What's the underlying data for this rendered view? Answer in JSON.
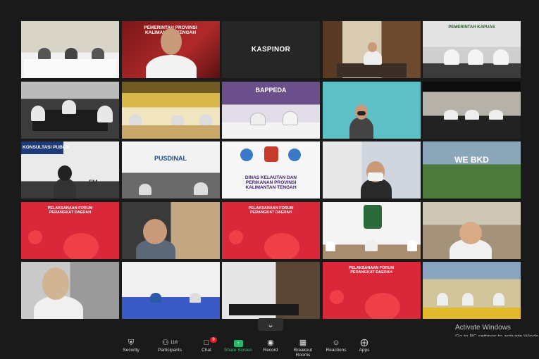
{
  "tiles": [
    {
      "id": "t1",
      "label": "",
      "theme": "meeting-room-white"
    },
    {
      "id": "t2",
      "label": "",
      "banner": "PEMERINTAH PROVINSI KALIMANTAN TENGAH"
    },
    {
      "id": "t3",
      "label": "KASPINOR"
    },
    {
      "id": "t4",
      "label": "",
      "theme": "office-wood"
    },
    {
      "id": "t5",
      "label": "",
      "banner": "PEMERINTAH KAPUAS"
    },
    {
      "id": "t6",
      "label": "",
      "theme": "conference"
    },
    {
      "id": "t7",
      "label": "",
      "theme": "hall-gold"
    },
    {
      "id": "t8",
      "label": "",
      "banner": "BAPPEDA"
    },
    {
      "id": "t9",
      "label": "",
      "theme": "teal-room"
    },
    {
      "id": "t10",
      "label": "",
      "theme": "dark-hall"
    },
    {
      "id": "t11",
      "label": "",
      "banner": "KONSULTASI PUBLIK",
      "footer": "5M"
    },
    {
      "id": "t12",
      "label": "",
      "banner": "PUSDINAL"
    },
    {
      "id": "t13",
      "label": "",
      "banner": "DINAS KELAUTAN DAN PERIKANAN PROVINSI KALIMANTAN TENGAH"
    },
    {
      "id": "t14",
      "label": "",
      "theme": "masked-man"
    },
    {
      "id": "t15",
      "label": "",
      "banner": "WE BKD"
    },
    {
      "id": "t16",
      "label": "",
      "banner": "PELAKSANAAN FORUM PERANGKAT DAERAH"
    },
    {
      "id": "t17",
      "label": "",
      "theme": "man-closeup"
    },
    {
      "id": "t18",
      "label": "",
      "banner": "PELAKSANAAN FORUM PERANGKAT DAERAH"
    },
    {
      "id": "t19",
      "label": "",
      "theme": "stage-flags"
    },
    {
      "id": "t20",
      "label": "",
      "theme": "boy-closeup"
    },
    {
      "id": "t21",
      "label": "",
      "theme": "woman-closeup"
    },
    {
      "id": "t22",
      "label": "",
      "theme": "blue-hall"
    },
    {
      "id": "t23",
      "label": "",
      "theme": "empty-room"
    },
    {
      "id": "t24",
      "label": "",
      "banner": "PELAKSANAAN FORUM PERANGKAT DAERAH"
    },
    {
      "id": "t25",
      "label": "",
      "theme": "outdoor"
    }
  ],
  "toolbar": {
    "security": "Security",
    "participants": "Participants",
    "participants_count": "116",
    "chat": "Chat",
    "chat_badge": "9",
    "share_screen": "Share Screen",
    "record": "Record",
    "breakout_rooms": "Breakout Rooms",
    "reactions": "Reactions",
    "apps": "Apps"
  },
  "watermark": {
    "title": "Activate Windows",
    "subtitle": "Go to PC settings to activate Windo"
  },
  "colors": {
    "active_speaker": "#c8d53c",
    "share_green": "#25b86a",
    "forum_red": "#d8283a"
  }
}
